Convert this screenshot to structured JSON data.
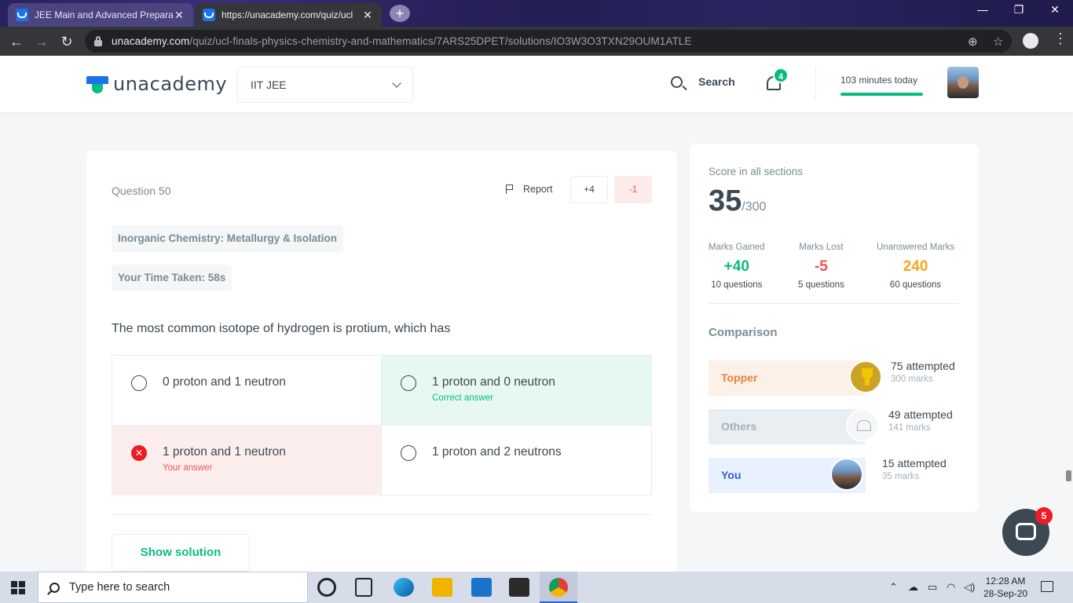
{
  "browser": {
    "tabs": [
      {
        "title": "JEE Main and Advanced Preparat",
        "active": false
      },
      {
        "title": "https://unacademy.com/quiz/ucl",
        "active": true
      }
    ],
    "url_host": "unacademy.com",
    "url_path": "/quiz/ucl-finals-physics-chemistry-and-mathematics/7ARS25DPET/solutions/IO3W3O3TXN29OUM1ATLE"
  },
  "header": {
    "logo_text": "unacademy",
    "goal": "IIT JEE",
    "search_label": "Search",
    "notification_count": "4",
    "minutes_today": "103 minutes today"
  },
  "question": {
    "number_label": "Question 50",
    "report_label": "Report",
    "positive_marks": "+4",
    "negative_marks": "-1",
    "topic": "Inorganic Chemistry: Metallurgy & Isolation",
    "time_taken": "Your Time Taken: 58s",
    "text": "The most common isotope of hydrogen is protium, which has",
    "options": [
      {
        "text": "0 proton and 1 neutron",
        "hint": "",
        "state": "neutral"
      },
      {
        "text": "1 proton and 0 neutron",
        "hint": "Correct answer",
        "state": "correct"
      },
      {
        "text": "1 proton and 1 neutron",
        "hint": "Your answer",
        "state": "wrong"
      },
      {
        "text": "1 proton and 2 neutrons",
        "hint": "",
        "state": "neutral"
      }
    ],
    "show_solution_label": "Show solution"
  },
  "score": {
    "title": "Score in all sections",
    "value": "35",
    "total": "/300",
    "stats": [
      {
        "label": "Marks Gained",
        "value": "+40",
        "sub": "10 questions",
        "color": "#08bd80"
      },
      {
        "label": "Marks Lost",
        "value": "-5",
        "sub": "5 questions",
        "color": "#eb5757"
      },
      {
        "label": "Unanswered Marks",
        "value": "240",
        "sub": "60 questions",
        "color": "#f5a623"
      }
    ],
    "comparison_title": "Comparison",
    "comparison": [
      {
        "name": "Topper",
        "attempted": "75 attempted",
        "marks": "300 marks",
        "bg": "#fdf0e6",
        "color": "#e8833a"
      },
      {
        "name": "Others",
        "attempted": "49 attempted",
        "marks": "141 marks",
        "bg": "#e9eef2",
        "color": "#a3b1b9"
      },
      {
        "name": "You",
        "attempted": "15 attempted",
        "marks": "35 marks",
        "bg": "#e8f1fd",
        "color": "#2d62c8"
      }
    ]
  },
  "chat_badge": "5",
  "taskbar": {
    "search_placeholder": "Type here to search",
    "time": "12:28 AM",
    "date": "28-Sep-20"
  }
}
